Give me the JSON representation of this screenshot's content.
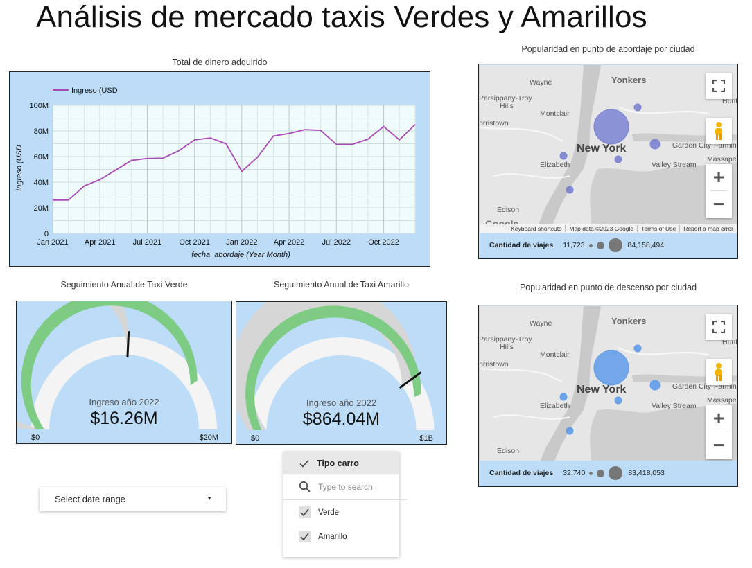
{
  "page": {
    "title": "Análisis de mercado taxis Verdes y Amarillos"
  },
  "chart_data": [
    {
      "type": "line",
      "title": "Total de dinero adquirido",
      "xlabel": "fecha_abordaje (Year Month)",
      "ylabel": "Ingreso (USD",
      "legend": "top-left",
      "grid": true,
      "ylim": [
        0,
        100000000
      ],
      "y_ticks": [
        "0",
        "20M",
        "40M",
        "60M",
        "80M",
        "100M"
      ],
      "x_ticks": [
        "Jan 2021",
        "Apr 2021",
        "Jul 2021",
        "Oct 2021",
        "Jan 2022",
        "Apr 2022",
        "Jul 2022",
        "Oct 2022"
      ],
      "x": [
        "2021-01",
        "2021-02",
        "2021-03",
        "2021-04",
        "2021-05",
        "2021-06",
        "2021-07",
        "2021-08",
        "2021-09",
        "2021-10",
        "2021-11",
        "2021-12",
        "2022-01",
        "2022-02",
        "2022-03",
        "2022-04",
        "2022-05",
        "2022-06",
        "2022-07",
        "2022-08",
        "2022-09",
        "2022-10",
        "2022-11",
        "2022-12"
      ],
      "series": [
        {
          "name": "Ingreso (USD",
          "color": "#a94ab8",
          "values": [
            26000000,
            26000000,
            37000000,
            42000000,
            49500000,
            57000000,
            58500000,
            58800000,
            64500000,
            73000000,
            74500000,
            70000000,
            48500000,
            59500000,
            76000000,
            78000000,
            81000000,
            80500000,
            69500000,
            69500000,
            73500000,
            83500000,
            73000000,
            85000000
          ]
        }
      ]
    },
    {
      "type": "gauge",
      "title": "Seguimiento Anual de Taxi Verde",
      "label": "Ingreso año 2022",
      "value_text": "$16.26M",
      "value": 16260000,
      "min": 0,
      "max": 20000000,
      "min_label": "$0",
      "max_label": "$20M",
      "target_fraction": 0.515,
      "bar_color": "#7ecb84"
    },
    {
      "type": "gauge",
      "title": "Seguimiento Anual de Taxi Amarillo",
      "label": "Ingreso año 2022",
      "value_text": "$864.04M",
      "value": 864040000,
      "min": 0,
      "max": 1000000000,
      "min_label": "$0",
      "max_label": "$1B",
      "target_fraction": 0.8,
      "bar_color": "#7ecb84"
    }
  ],
  "maps": [
    {
      "title": "Popularidad en punto de abordaje por ciudad",
      "bubble_color": "#7b82d2",
      "legend_label": "Cantidad de viajes",
      "legend_min": "11,723",
      "legend_max": "84,158,494"
    },
    {
      "title": "Popularidad en punto de descenso por ciudad",
      "bubble_color": "#5f9bea",
      "legend_label": "Cantidad de viajes",
      "legend_min": "32,740",
      "legend_max": "83,418,053"
    }
  ],
  "map_common": {
    "places": {
      "yonkers": "Yonkers",
      "wayne": "Wayne",
      "parsippany": "Parsippany-Troy",
      "hills": "Hills",
      "montclair": "Montclair",
      "morristown": "orristown",
      "newyork": "New York",
      "garden": "Garden City",
      "farmingdale": "Farmin",
      "massapequa": "Massape",
      "elizabeth": "Elizabeth",
      "valley": "Valley Stream",
      "edison": "Edison",
      "hunt": "Hunt"
    },
    "attribution": {
      "shortcuts": "Keyboard shortcuts",
      "data": "Map data ©2023 Google",
      "terms": "Terms of Use",
      "report": "Report a map error"
    },
    "google": "Google",
    "fullscreen_icon": "fullscreen-icon",
    "pegman_icon": "pegman-icon"
  },
  "controls": {
    "date_range": "Select date range",
    "filter": {
      "header": "Tipo carro",
      "search_placeholder": "Type to search",
      "options": [
        {
          "label": "Verde",
          "checked": true
        },
        {
          "label": "Amarillo",
          "checked": true
        }
      ]
    }
  }
}
